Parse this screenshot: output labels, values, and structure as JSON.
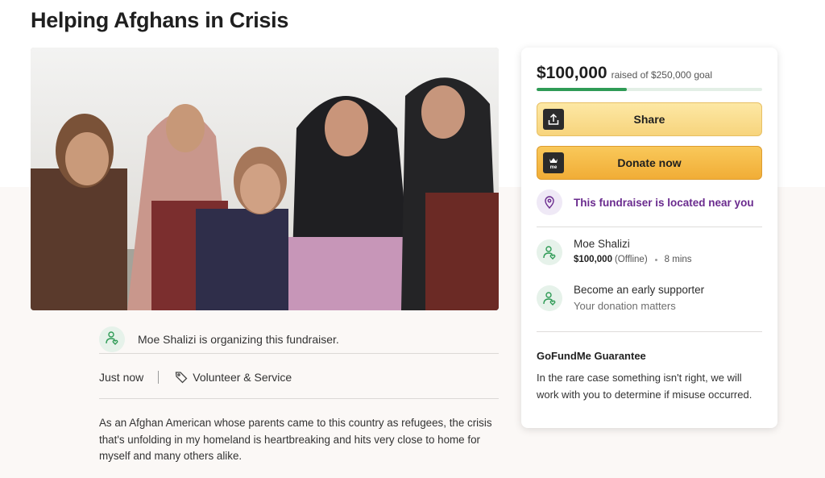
{
  "campaign": {
    "title": "Helping Afghans in Crisis",
    "organizer_text": "Moe Shalizi is organizing this fundraiser.",
    "posted_time": "Just now",
    "category": "Volunteer & Service",
    "story": "As an Afghan American whose parents came to this country as refugees, the crisis that's unfolding in my homeland is heartbreaking and hits very close to home for myself and many others alike."
  },
  "donation_card": {
    "raised_amount": "$100,000",
    "goal_text": "raised of $250,000 goal",
    "progress_fraction": 0.4,
    "share_label": "Share",
    "donate_label": "Donate now",
    "donate_icon_text": "me",
    "location_text": "This fundraiser is located near you",
    "donors": [
      {
        "name": "Moe Shalizi",
        "amount": "$100,000",
        "status": "(Offline)",
        "time": "8 mins"
      }
    ],
    "early_supporter": {
      "title": "Become an early supporter",
      "subtitle": "Your donation matters"
    },
    "guarantee_title": "GoFundMe Guarantee",
    "guarantee_text": "In the rare case something isn't right, we will work with you to determine if misuse occurred."
  },
  "colors": {
    "progress_fill": "#2f9b56",
    "share_button": "#f7d47c",
    "donate_button": "#f1ad36",
    "location_accent": "#6a2b8e"
  },
  "icons": {
    "share": "share-upload-icon",
    "donate": "gofundme-logo-icon",
    "location": "location-pin-icon",
    "organizer": "user-heart-icon",
    "category": "tag-icon"
  }
}
